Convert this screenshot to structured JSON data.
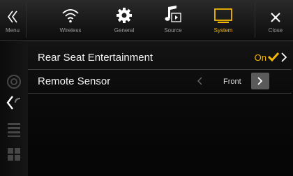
{
  "tabs": [
    {
      "id": "menu",
      "label": "Menu",
      "icon": "double-chevron-left-icon"
    },
    {
      "id": "wireless",
      "label": "Wireless",
      "icon": "wifi-icon"
    },
    {
      "id": "general",
      "label": "General",
      "icon": "gear-icon"
    },
    {
      "id": "source",
      "label": "Source",
      "icon": "music-note-icon"
    },
    {
      "id": "system",
      "label": "System",
      "icon": "monitor-icon",
      "active": true
    },
    {
      "id": "close",
      "label": "Close",
      "icon": "close-icon"
    }
  ],
  "settings": {
    "rear_seat": {
      "label": "Rear Seat Entertainment",
      "value": "On"
    },
    "remote_sensor": {
      "label": "Remote Sensor",
      "value": "Front"
    }
  },
  "sidebar_icons": [
    "camera-icon",
    "back-arrow-icon",
    "grid-icon",
    "apps-icon"
  ],
  "colors": {
    "accent": "#f5b800",
    "background": "#000000",
    "inactive_label": "#9a9a9a"
  }
}
